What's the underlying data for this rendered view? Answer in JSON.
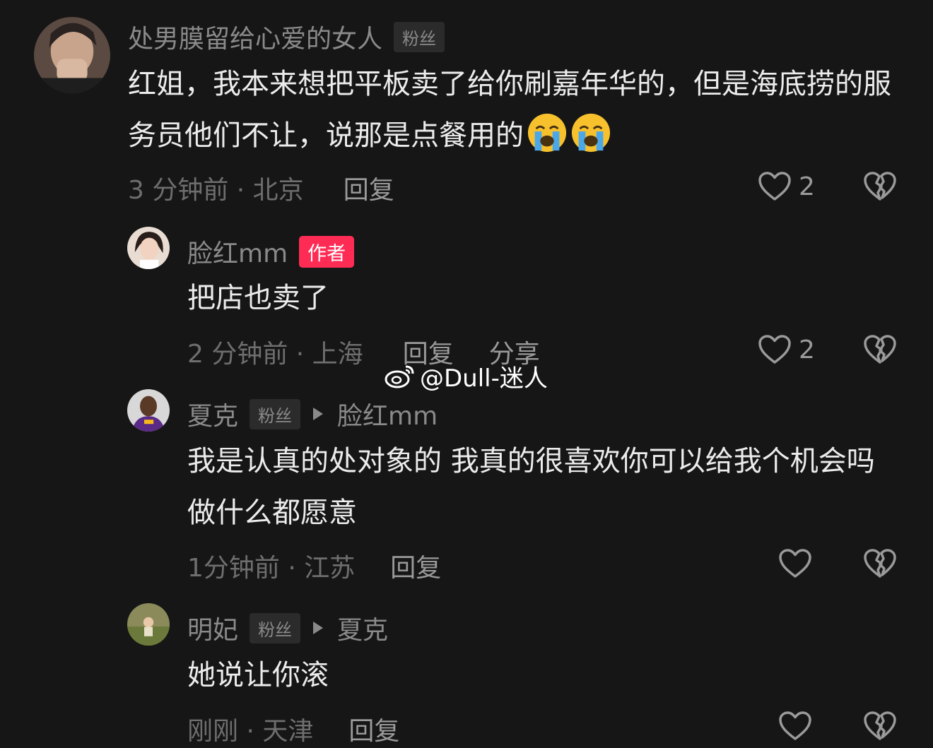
{
  "comments": [
    {
      "username": "处男膜留给心爱的女人",
      "badge": "粉丝",
      "text": "红姐，我本来想把平板卖了给你刷嘉年华的，但是海底捞的服务员他们不让，说那是点餐用的",
      "emoji": "loudly-crying-face-emoji",
      "emoji_count": 2,
      "time_location": "3 分钟前 · 北京",
      "reply_label": "回复",
      "likes": "2"
    },
    {
      "username": "脸红mm",
      "badge": "作者",
      "text": "把店也卖了",
      "time_location": "2 分钟前 · 上海",
      "reply_label": "回复",
      "share_label": "分享",
      "likes": "2"
    },
    {
      "username": "夏克",
      "badge": "粉丝",
      "reply_to": "脸红mm",
      "text": "我是认真的处对象的 我真的很喜欢你可以给我个机会吗 做什么都愿意",
      "time_location": "1分钟前 · 江苏",
      "reply_label": "回复"
    },
    {
      "username": "明妃",
      "badge": "粉丝",
      "reply_to": "夏克",
      "text": "她说让你滚",
      "time_location": "刚刚 · 天津",
      "reply_label": "回复"
    }
  ],
  "watermark": "@Dull-迷人",
  "colors": {
    "background": "#161616",
    "author_badge": "#fe2c55",
    "muted_text": "#8a8a8a"
  }
}
